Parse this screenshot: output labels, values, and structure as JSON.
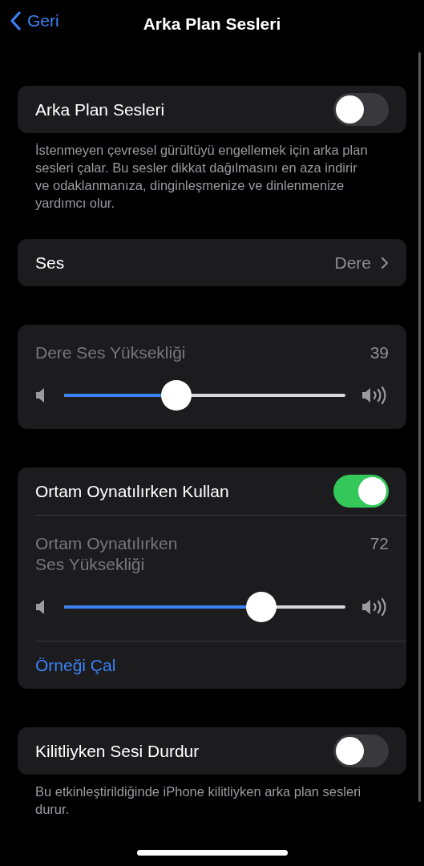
{
  "nav": {
    "back": "Geri",
    "title": "Arka Plan Sesleri"
  },
  "groups": [
    {
      "rows": [
        {
          "kind": "toggle",
          "label": "Arka Plan Sesleri",
          "on": false
        }
      ],
      "footer": "İstenmeyen çevresel gürültüyü engellemek için arka plan sesleri çalar. Bu sesler dikkat dağılmasını en aza indirir ve odaklanmanıza, dinginleşmenize ve dinlenmenize yardımcı olur."
    },
    {
      "rows": [
        {
          "kind": "nav",
          "label": "Ses",
          "value": "Dere"
        }
      ]
    },
    {
      "rows": [
        {
          "kind": "slider",
          "label": "Dere Ses Yüksekliği",
          "reading": "39",
          "level": 0.4,
          "disabled": true
        }
      ]
    },
    {
      "rows": [
        {
          "kind": "toggle",
          "label": "Ortam Oynatılırken Kullan",
          "on": true
        },
        {
          "kind": "slider",
          "label": "Ortam Oynatılırken\nSes Yüksekliği",
          "reading": "72",
          "level": 0.7,
          "disabled": true
        },
        {
          "kind": "link",
          "label": "Örneği Çal"
        }
      ]
    },
    {
      "rows": [
        {
          "kind": "toggle",
          "label": "Kilitliyken Sesi Durdur",
          "on": false
        }
      ],
      "footer": "Bu etkinleştirildiğinde iPhone kilitliyken arka plan sesleri durur."
    }
  ]
}
